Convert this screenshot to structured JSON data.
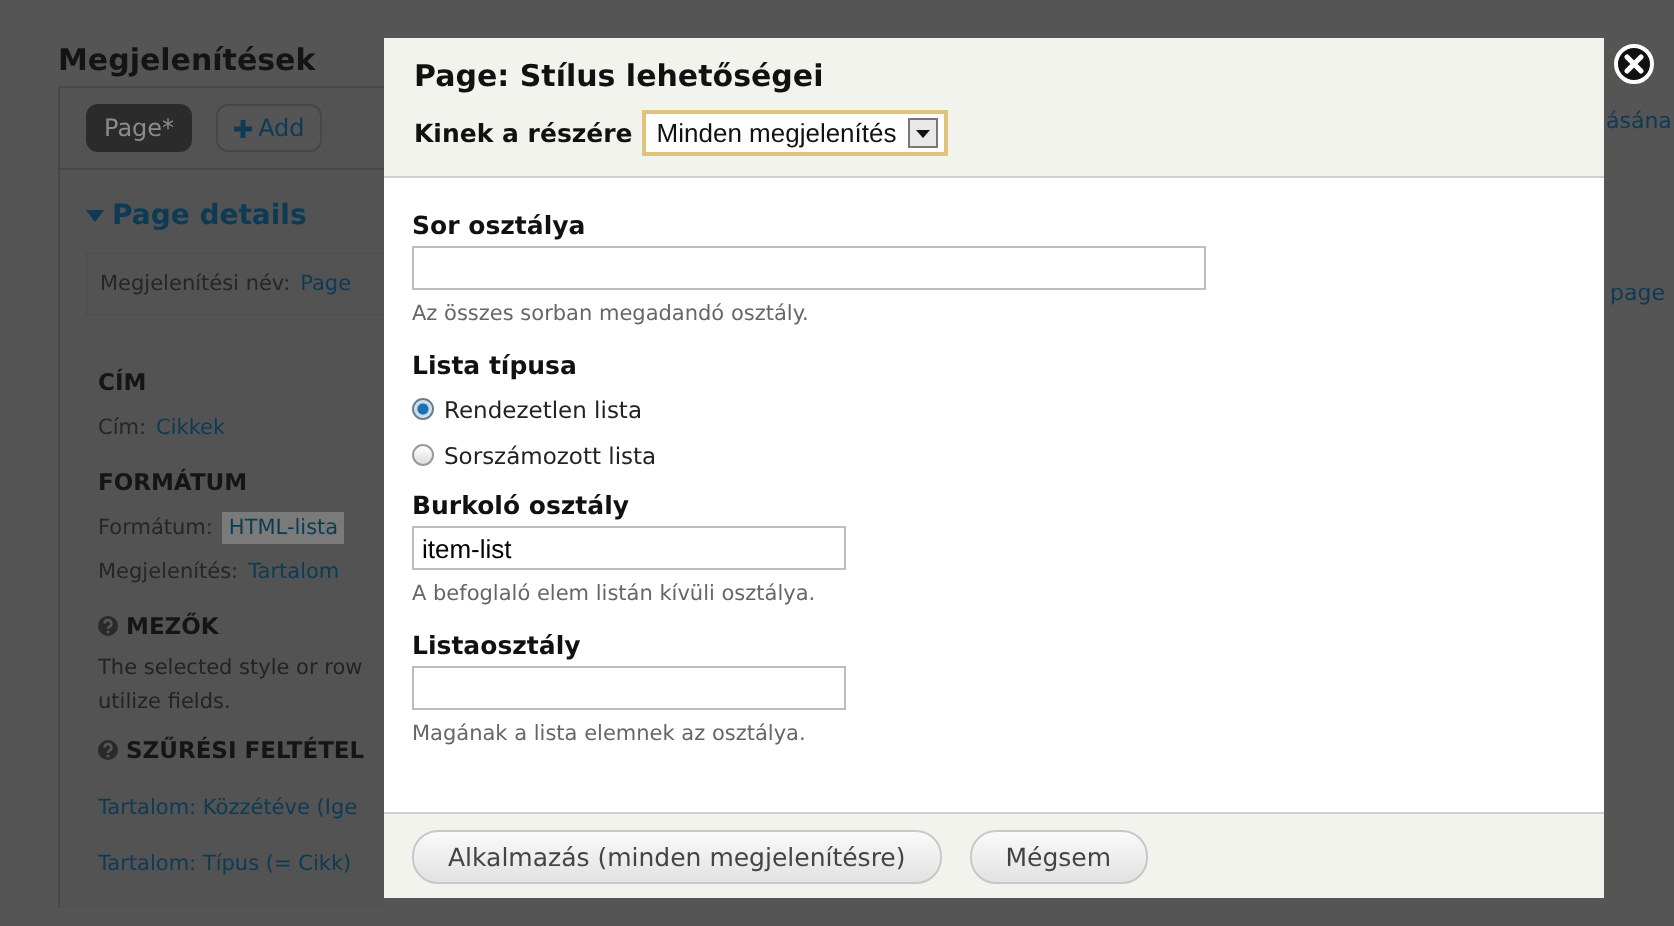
{
  "page": {
    "title": "Megjelenítések",
    "tabs": [
      {
        "label": "Page*",
        "selected": true
      },
      {
        "label": "Add",
        "selected": false
      }
    ],
    "details": {
      "title": "Page details",
      "expanded": true,
      "display_name": {
        "label": "Megjelenítési név:",
        "value": "Page"
      },
      "sections": [
        {
          "kind": "heading",
          "text": "CÍM"
        },
        {
          "kind": "setting",
          "label": "Cím:",
          "value": "Cikkek",
          "highlighted": false
        },
        {
          "kind": "heading",
          "text": "FORMÁTUM"
        },
        {
          "kind": "setting",
          "label": "Formátum:",
          "value": "HTML-lista",
          "highlighted": true
        },
        {
          "kind": "setting",
          "label": "Megjelenítés:",
          "value": "Tartalom",
          "highlighted": false
        },
        {
          "kind": "help_heading",
          "text": "MEZŐK"
        },
        {
          "kind": "text",
          "text": "The selected style or row"
        },
        {
          "kind": "text",
          "text": "utilize fields."
        },
        {
          "kind": "help_heading",
          "text": "SZŰRÉSI FELTÉTEL"
        },
        {
          "kind": "link",
          "text": "Tartalom: Közzétéve (Ige"
        },
        {
          "kind": "link",
          "text": "Tartalom: Típus (= Cikk)"
        }
      ]
    }
  },
  "right_edge": [
    "ásána",
    "page"
  ],
  "dialog": {
    "title": "Page: Stílus lehetőségei",
    "scope": {
      "label": "Kinek a részére",
      "value": "Minden megjelenítés"
    },
    "fields": [
      {
        "kind": "wide_text",
        "label": "Sor osztálya",
        "description": "Az összes sorban megadandó osztály."
      },
      {
        "kind": "radios",
        "label": "Lista típusa",
        "options": [
          {
            "label": "Rendezetlen lista",
            "selected": true
          },
          {
            "label": "Sorszámozott lista",
            "selected": false
          }
        ]
      },
      {
        "kind": "text",
        "label": "Burkoló osztály",
        "value": "item-list",
        "description": "A befoglaló elem listán kívüli osztálya."
      },
      {
        "kind": "text",
        "label": "Listaosztály",
        "description": "Magának a lista elemnek az osztálya."
      }
    ],
    "buttons": [
      "Alkalmazás (minden megjelenítésre)",
      "Mégsem"
    ]
  }
}
